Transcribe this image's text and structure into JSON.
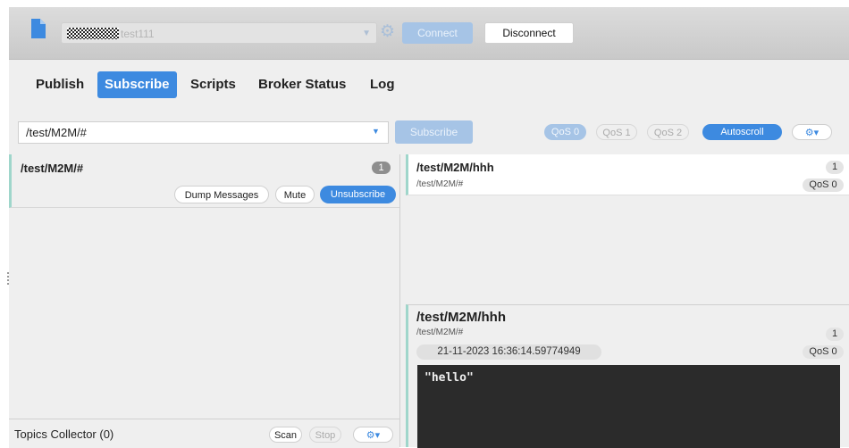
{
  "connection": {
    "name": "test111",
    "connect_label": "Connect",
    "disconnect_label": "Disconnect"
  },
  "tabs": [
    {
      "label": "Publish",
      "active": false
    },
    {
      "label": "Subscribe",
      "active": true
    },
    {
      "label": "Scripts",
      "active": false
    },
    {
      "label": "Broker Status",
      "active": false
    },
    {
      "label": "Log",
      "active": false
    }
  ],
  "subscribe_bar": {
    "topic_value": "/test/M2M/#",
    "subscribe_label": "Subscribe",
    "qos": [
      "QoS 0",
      "QoS 1",
      "QoS 2"
    ],
    "selected_qos": "QoS 0",
    "autoscroll_label": "Autoscroll"
  },
  "subscriptions": [
    {
      "topic": "/test/M2M/#",
      "count": "1",
      "dump_label": "Dump Messages",
      "mute_label": "Mute",
      "unsubscribe_label": "Unsubscribe"
    }
  ],
  "topics_collector": {
    "title": "Topics Collector (0)",
    "scan_label": "Scan",
    "stop_label": "Stop"
  },
  "messages": [
    {
      "topic": "/test/M2M/hhh",
      "subscription": "/test/M2M/#",
      "number": "1",
      "qos": "QoS 0"
    }
  ],
  "detail": {
    "topic": "/test/M2M/hhh",
    "subscription": "/test/M2M/#",
    "number": "1",
    "timestamp": "21-11-2023  16:36:14.59774949",
    "qos": "QoS 0",
    "payload": "\"hello\""
  },
  "colors": {
    "accent": "#3d8ae0",
    "accent_disabled": "#a6c4e6",
    "selection_border": "#9fd6cb",
    "payload_bg": "#2b2b2b"
  }
}
